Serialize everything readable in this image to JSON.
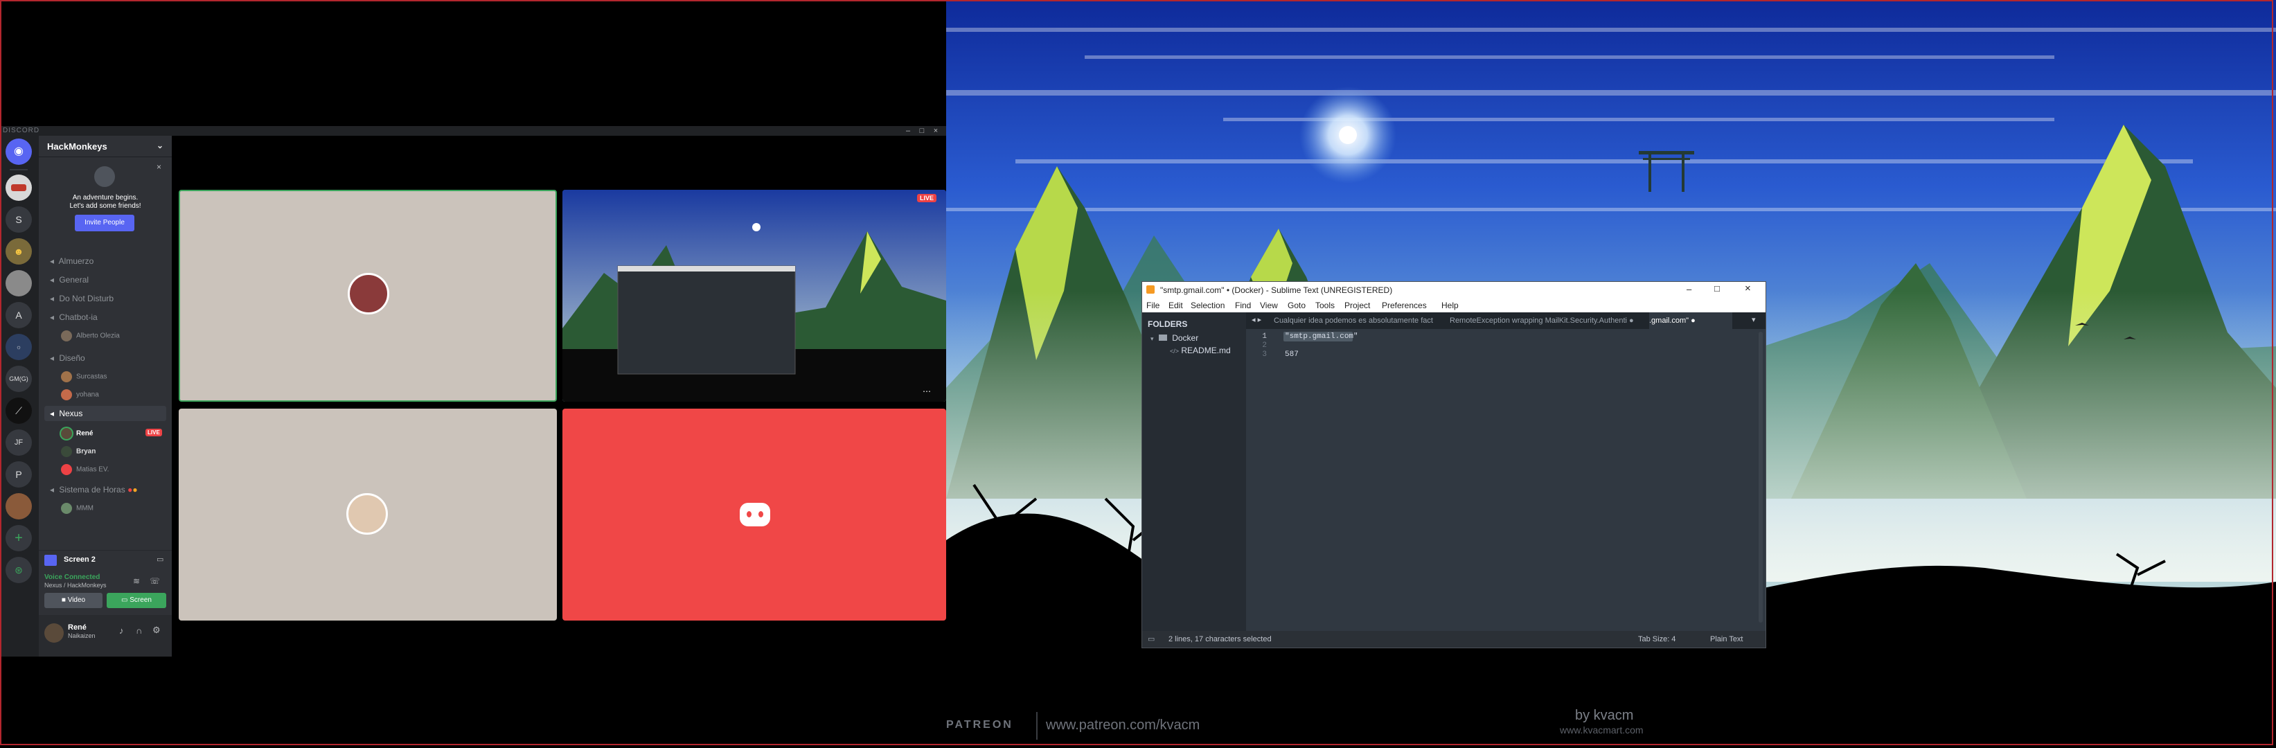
{
  "discord": {
    "title": "DISCORD",
    "server_name": "HackMonkeys",
    "welcome": {
      "line1": "An adventure begins.",
      "line2": "Let's add some friends!",
      "invite_label": "Invite People"
    },
    "guilds": [
      "S",
      "A",
      "GM(G)",
      "JF",
      "P"
    ],
    "channels": [
      {
        "name": "Almuerzo"
      },
      {
        "name": "General"
      },
      {
        "name": "Do Not Disturb"
      },
      {
        "name": "Chatbot-ia"
      },
      {
        "name": "Diseño"
      },
      {
        "name": "Nexus"
      },
      {
        "name": "Sistema de Horas"
      }
    ],
    "members": {
      "chatbot": [
        "Alberto Olezia"
      ],
      "diseno": [
        "Surcastas",
        "yohana"
      ],
      "nexus": [
        {
          "name": "René",
          "badge": "LIVE"
        },
        {
          "name": "Bryan"
        },
        {
          "name": "Matias EV."
        }
      ],
      "horas": [
        "MMM"
      ]
    },
    "screen_share": {
      "label": "Screen 2"
    },
    "voice": {
      "status": "Voice Connected",
      "channel": "Nexus / HackMonkeys",
      "video_label": "Video",
      "screen_label": "Screen"
    },
    "user": {
      "name": "René",
      "tag": "Naikaizen"
    },
    "stream_badge": "LIVE",
    "colors": {
      "blurple": "#5865f2",
      "green": "#3ba55c",
      "red": "#ed4245",
      "tile_bg": "#cbc3bb",
      "discord_tile": "#f04747"
    }
  },
  "sublime": {
    "title": "\"smtp.gmail.com\" • (Docker) - Sublime Text (UNREGISTERED)",
    "menu": [
      "File",
      "Edit",
      "Selection",
      "Find",
      "View",
      "Goto",
      "Tools",
      "Project",
      "Preferences",
      "Help"
    ],
    "sidebar": {
      "header": "FOLDERS",
      "folder": "Docker",
      "file": "README.md"
    },
    "tabs": [
      {
        "label": "Cualquier idea podemos es absolutamente fact"
      },
      {
        "label": "RemoteException wrapping MailKit.Security.Authenti"
      },
      {
        "label": ".gmail.com\""
      }
    ],
    "lines": [
      {
        "num": "1",
        "text": "\"smtp.gmail.com\""
      },
      {
        "num": "2",
        "text": ""
      },
      {
        "num": "3",
        "text": "587"
      }
    ],
    "status": {
      "selection": "2 lines, 17 characters selected",
      "tab_size": "Tab Size: 4",
      "syntax": "Plain Text"
    }
  },
  "watermark": {
    "patreon": "PATREON",
    "patreon_url": "www.patreon.com/kvacm",
    "by": "by kvacm",
    "site": "www.kvacmart.com"
  }
}
